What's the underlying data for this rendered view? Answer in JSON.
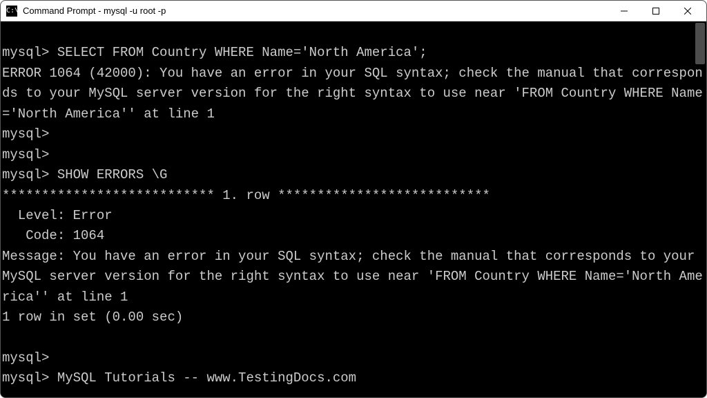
{
  "window": {
    "icon_glyph": "C:\\",
    "title": "Command Prompt - mysql  -u root -p"
  },
  "terminal": {
    "lines": [
      "",
      "mysql> SELECT FROM Country WHERE Name='North America';",
      "ERROR 1064 (42000): You have an error in your SQL syntax; check the manual that corresponds to your MySQL server version for the right syntax to use near 'FROM Country WHERE Name='North America'' at line 1",
      "mysql>",
      "mysql>",
      "mysql> SHOW ERRORS \\G",
      "*************************** 1. row ***************************",
      "  Level: Error",
      "   Code: 1064",
      "Message: You have an error in your SQL syntax; check the manual that corresponds to your MySQL server version for the right syntax to use near 'FROM Country WHERE Name='North America'' at line 1",
      "1 row in set (0.00 sec)",
      "",
      "mysql>",
      "mysql> MySQL Tutorials -- www.TestingDocs.com"
    ]
  }
}
